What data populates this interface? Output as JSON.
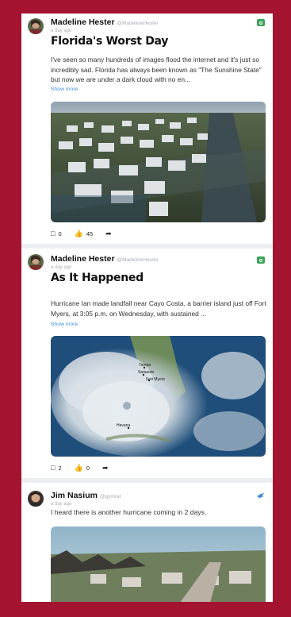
{
  "posts": [
    {
      "author": "Madeline Hester",
      "handle": "@MadelineHester",
      "time": "a day ago",
      "title": "Florida's Worst Day",
      "body": "I've seen so many hundreds of images flood the internet and it's just so incredibly sad. Florida has always been known as \"The Sunshine State\" but now we are under a dark cloud with no en...",
      "show_more": "Show more",
      "comments": "0",
      "likes": "45",
      "source_icon": "camera-icon"
    },
    {
      "author": "Madeline Hester",
      "handle": "@MadelineHester",
      "time": "a day ago",
      "title": "As It Happened",
      "body": "Hurricane Ian made landfall near Cayo Costa, a barrier island just off Fort Myers, at 3:05 p.m. on Wednesday, with sustained ...",
      "show_more": "Show more",
      "comments": "2",
      "likes": "0",
      "source_icon": "camera-icon",
      "map_labels": {
        "tampa": "Tampa",
        "sarasota": "Sarasota",
        "fort_myers": "Fort Myers",
        "havana": "Havana"
      }
    },
    {
      "author": "Jim Nasium",
      "handle": "@gymrat",
      "time": "a day ago",
      "body": "I heard there is another hurricane coming in 2 days.",
      "source_icon": "bird-icon"
    }
  ],
  "colors": {
    "accent": "#a4132f",
    "link": "#3a8dde",
    "badge": "#3aa457"
  }
}
